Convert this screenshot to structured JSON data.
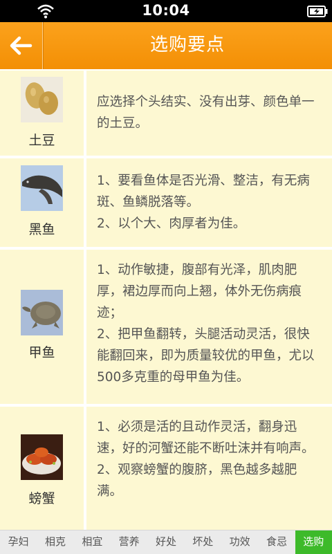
{
  "status": {
    "time": "10:04"
  },
  "header": {
    "title": "选购要点"
  },
  "items": [
    {
      "name": "土豆",
      "image": "potato",
      "lines": [
        "应选择个头结实、没有出芽、颜色单一的土豆。"
      ]
    },
    {
      "name": "黑鱼",
      "image": "snakehead-fish",
      "lines": [
        "1、要看鱼体是否光滑、整洁，有无病斑、鱼鳞脱落等。",
        "2、以个大、肉厚者为佳。"
      ]
    },
    {
      "name": "甲鱼",
      "image": "soft-shell-turtle",
      "lines": [
        "1、动作敏捷，腹部有光泽，肌肉肥厚，裙边厚而向上翘，体外无伤病痕迹；",
        "2、把甲鱼翻转，头腿活动灵活，很快能翻回来，即为质量较优的甲鱼，尤以500多克重的母甲鱼为佳。"
      ]
    },
    {
      "name": "螃蟹",
      "image": "crabs",
      "lines": [
        "1、必须是活的且动作灵活，翻身迅速，好的河蟹还能不断吐沫并有响声。",
        "2、观察螃蟹的腹脐，黑色越多越肥满。"
      ]
    }
  ],
  "tabs": [
    "孕妇",
    "相克",
    "相宜",
    "营养",
    "好处",
    "坏处",
    "功效",
    "食忌",
    "选购"
  ],
  "active_tab": "选购",
  "colors": {
    "header": "#f59508",
    "row_bg": "#fdf8d2",
    "active_tab": "#3dba2a"
  }
}
